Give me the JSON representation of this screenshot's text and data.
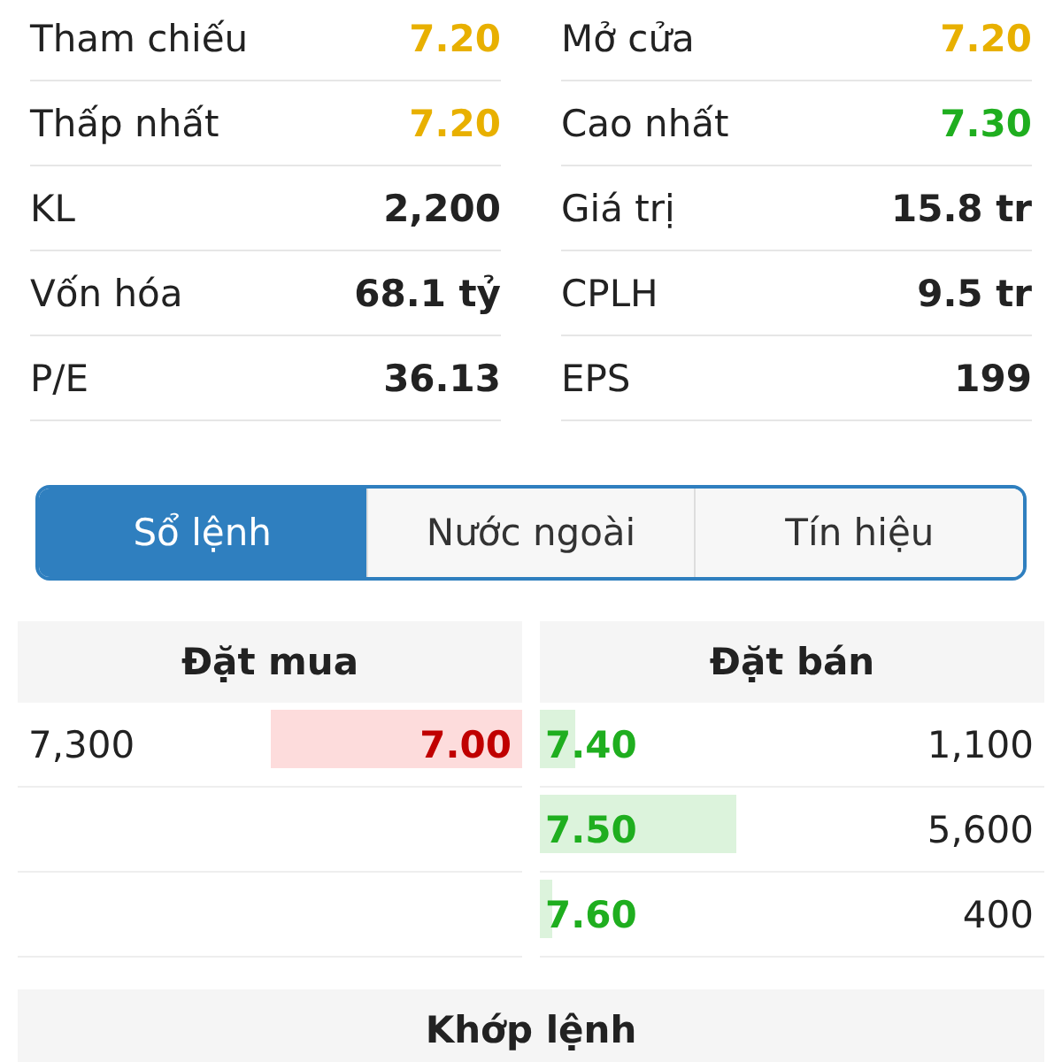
{
  "stats": [
    {
      "label": "Tham chiếu",
      "value": "7.20",
      "kind": "ref"
    },
    {
      "label": "Mở cửa",
      "value": "7.20",
      "kind": "ref"
    },
    {
      "label": "Thấp nhất",
      "value": "7.20",
      "kind": "ref"
    },
    {
      "label": "Cao nhất",
      "value": "7.30",
      "kind": "up"
    },
    {
      "label": "KL",
      "value": "2,200",
      "kind": "plain"
    },
    {
      "label": "Giá trị",
      "value": "15.8 tr",
      "kind": "plain"
    },
    {
      "label": "Vốn hóa",
      "value": "68.1 tỷ",
      "kind": "plain"
    },
    {
      "label": "CPLH",
      "value": "9.5 tr",
      "kind": "plain"
    },
    {
      "label": "P/E",
      "value": "36.13",
      "kind": "plain"
    },
    {
      "label": "EPS",
      "value": "199",
      "kind": "plain"
    }
  ],
  "tabs": [
    {
      "label": "Sổ lệnh",
      "selected": true
    },
    {
      "label": "Nước ngoài",
      "selected": false
    },
    {
      "label": "Tín hiệu",
      "selected": false
    }
  ],
  "order_book": {
    "buy_title": "Đặt mua",
    "sell_title": "Đặt bán",
    "buy": [
      {
        "volume": "7,300",
        "price": "7.00",
        "level": 0.5
      }
    ],
    "sell": [
      {
        "price": "7.40",
        "volume": "1,100",
        "level": 0.07
      },
      {
        "price": "7.50",
        "volume": "5,600",
        "level": 0.39
      },
      {
        "price": "7.60",
        "volume": "400",
        "level": 0.025
      }
    ]
  },
  "matched_title": "Khớp lệnh"
}
